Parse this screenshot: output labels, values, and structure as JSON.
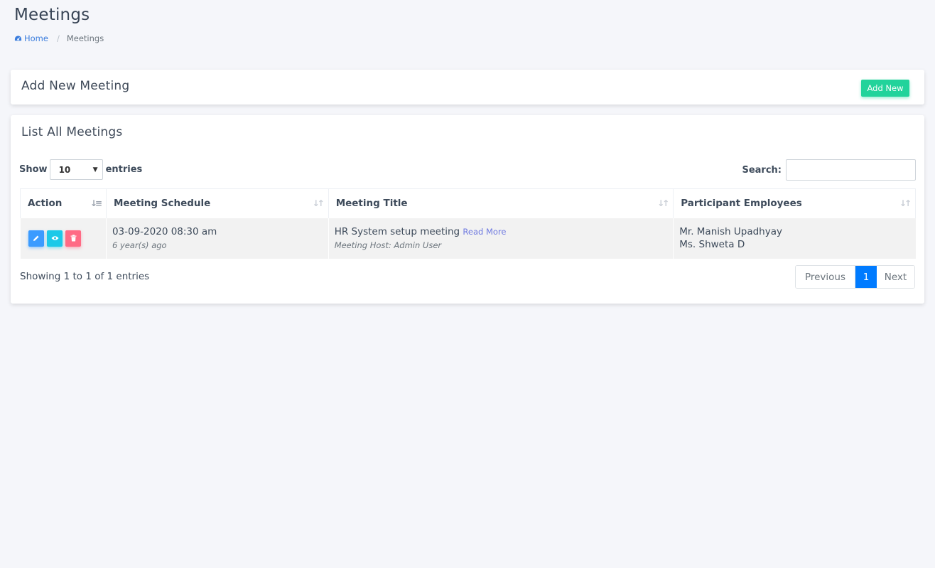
{
  "page": {
    "title": "Meetings"
  },
  "breadcrumb": {
    "home": "Home",
    "current": "Meetings"
  },
  "add_card": {
    "title": "Add New Meeting",
    "button": "Add New"
  },
  "list_card": {
    "title": "List All Meetings",
    "length": {
      "label_before": "Show",
      "value": "10",
      "label_after": "entries"
    },
    "search": {
      "label": "Search:",
      "value": ""
    },
    "columns": [
      "Action",
      "Meeting Schedule",
      "Meeting Title",
      "Participant Employees"
    ],
    "rows": [
      {
        "schedule": "03-09-2020 08:30 am",
        "schedule_ago": "6 year(s) ago",
        "title": "HR System setup meeting",
        "read_more": "Read More",
        "host": "Meeting Host: Admin User",
        "employees": [
          "Mr. Manish Upadhyay",
          "Ms. Shweta D"
        ]
      }
    ],
    "info": "Showing 1 to 1 of 1 entries",
    "pagination": {
      "previous": "Previous",
      "current": "1",
      "next": "Next"
    }
  },
  "colors": {
    "add_button": "#22d39b",
    "edit_button": "#3b9bff",
    "view_button": "#1cc9e8",
    "delete_button": "#ff6b85",
    "page_active": "#007bff",
    "link": "#3b7ddd"
  },
  "icons": {
    "home": "dashboard-icon",
    "edit": "pencil-icon",
    "view": "eye-icon",
    "delete": "trash-icon",
    "sort": "sort-icon",
    "select": "chevron-down-icon"
  }
}
